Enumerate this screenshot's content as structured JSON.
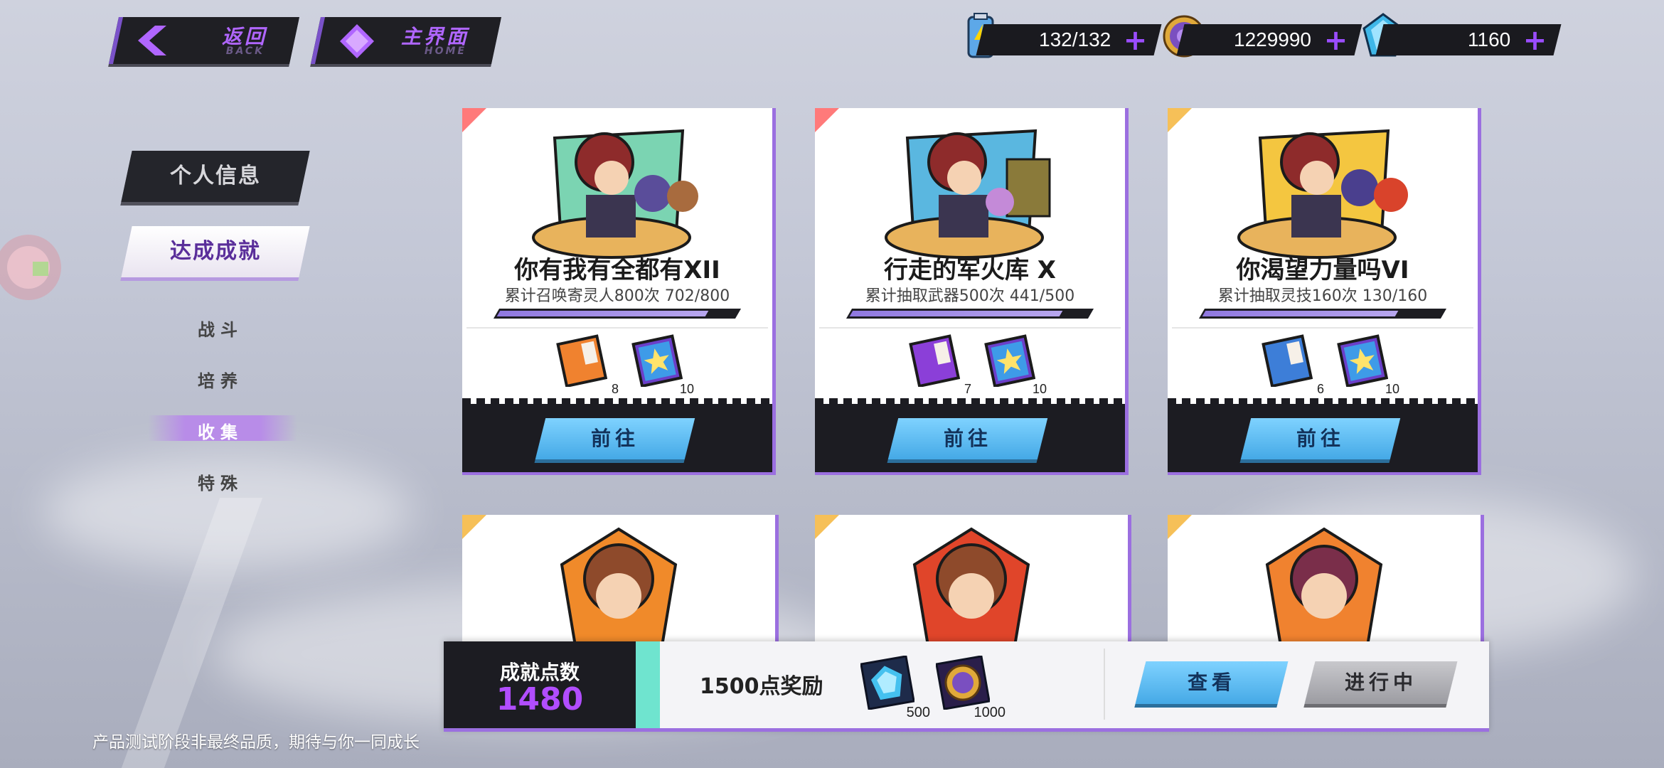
{
  "nav": {
    "back": {
      "cn": "返回",
      "en": "BACK"
    },
    "home": {
      "cn": "主界面",
      "en": "HOME"
    }
  },
  "resources": [
    {
      "icon": "energy-battery-icon",
      "value": "132/132"
    },
    {
      "icon": "gold-coin-icon",
      "value": "1229990"
    },
    {
      "icon": "blue-crystal-icon",
      "value": "1160"
    }
  ],
  "menu": {
    "personal_info": "个人信息",
    "achievements": "达成成就",
    "sub_items": [
      "战斗",
      "培养",
      "收集",
      "特殊"
    ],
    "active_sub": "收集"
  },
  "cards": [
    {
      "title": "你有我有全都有XII",
      "desc": "累计召唤寄灵人800次",
      "progress_text": "702/800",
      "progress": 0.8775,
      "rewards": [
        {
          "icon": "soul-contract-card-icon",
          "count": "8"
        },
        {
          "icon": "blue-star-card-icon",
          "count": "10"
        }
      ],
      "button": "前往",
      "corner_color": "#ff7a7a"
    },
    {
      "title": "行走的军火库 X",
      "desc": "累计抽取武器500次",
      "progress_text": "441/500",
      "progress": 0.882,
      "rewards": [
        {
          "icon": "weapon-ticket-card-icon",
          "count": "7"
        },
        {
          "icon": "blue-star-card-icon",
          "count": "10"
        }
      ],
      "button": "前往",
      "corner_color": "#ff7a7a"
    },
    {
      "title": "你渴望力量吗VI",
      "desc": "累计抽取灵技160次",
      "progress_text": "130/160",
      "progress": 0.8125,
      "rewards": [
        {
          "icon": "skill-ticket-card-icon",
          "count": "6"
        },
        {
          "icon": "blue-star-card-icon",
          "count": "10"
        }
      ],
      "button": "前往",
      "corner_color": "#f6c058"
    }
  ],
  "bottom_panel": {
    "label": "成就点数",
    "points": "1480",
    "reward_text": "1500点奖励",
    "rewards": [
      {
        "icon": "blue-crystal-icon",
        "count": "500"
      },
      {
        "icon": "gold-coin-icon",
        "count": "1000"
      }
    ],
    "view_button": "查看",
    "status_button": "进行中"
  },
  "disclaimer": "产品测试阶段非最终品质，期待与你一同成长"
}
